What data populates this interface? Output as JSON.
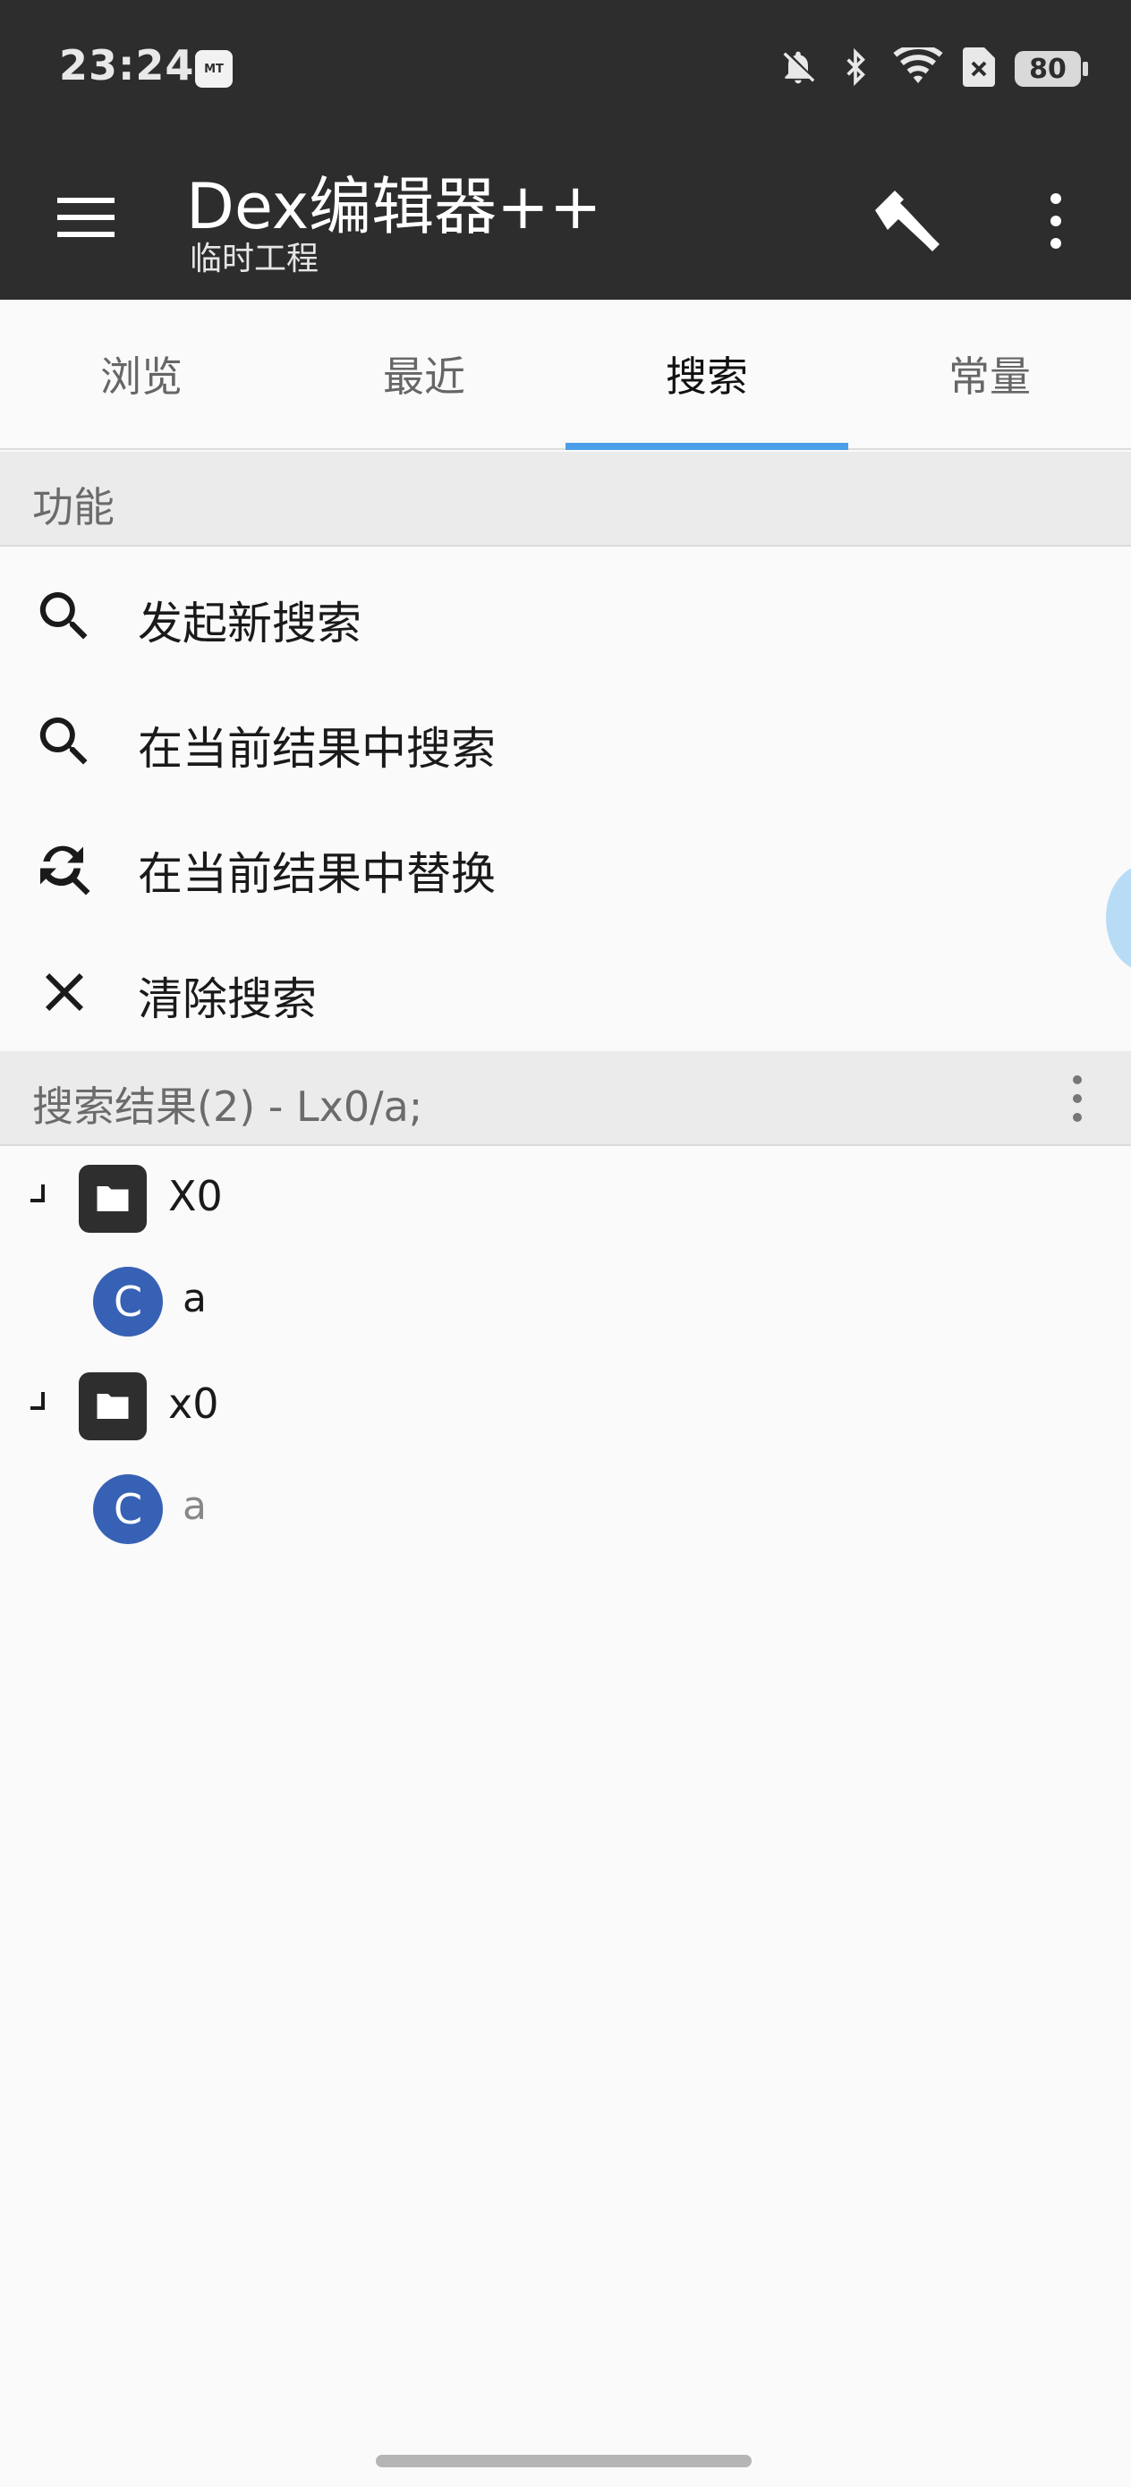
{
  "status_bar": {
    "time": "23:24",
    "app_badge": "MT",
    "battery": "80",
    "icons": [
      "bell-off-icon",
      "bluetooth-icon",
      "wifi-icon",
      "sim-error-icon",
      "battery-icon"
    ]
  },
  "app_bar": {
    "title": "Dex编辑器++",
    "subtitle": "临时工程",
    "icons": [
      "menu-icon",
      "hammer-icon",
      "more-vert-icon"
    ]
  },
  "tabs": [
    {
      "label": "浏览",
      "active": false
    },
    {
      "label": "最近",
      "active": false
    },
    {
      "label": "搜索",
      "active": true
    },
    {
      "label": "常量",
      "active": false
    }
  ],
  "accent_color": "#4a9fe8",
  "functions": {
    "header": "功能",
    "items": [
      {
        "label": "发起新搜索",
        "icon": "search-icon"
      },
      {
        "label": "在当前结果中搜索",
        "icon": "search-icon"
      },
      {
        "label": "在当前结果中替换",
        "icon": "search-replace-icon"
      },
      {
        "label": "清除搜索",
        "icon": "close-icon"
      }
    ]
  },
  "results": {
    "header": "搜索结果(2) - Lx0/a;",
    "tree": [
      {
        "package": "X0",
        "class_badge": "C",
        "class_name": "a"
      },
      {
        "package": "x0",
        "class_badge": "C",
        "class_name": "a"
      }
    ]
  }
}
